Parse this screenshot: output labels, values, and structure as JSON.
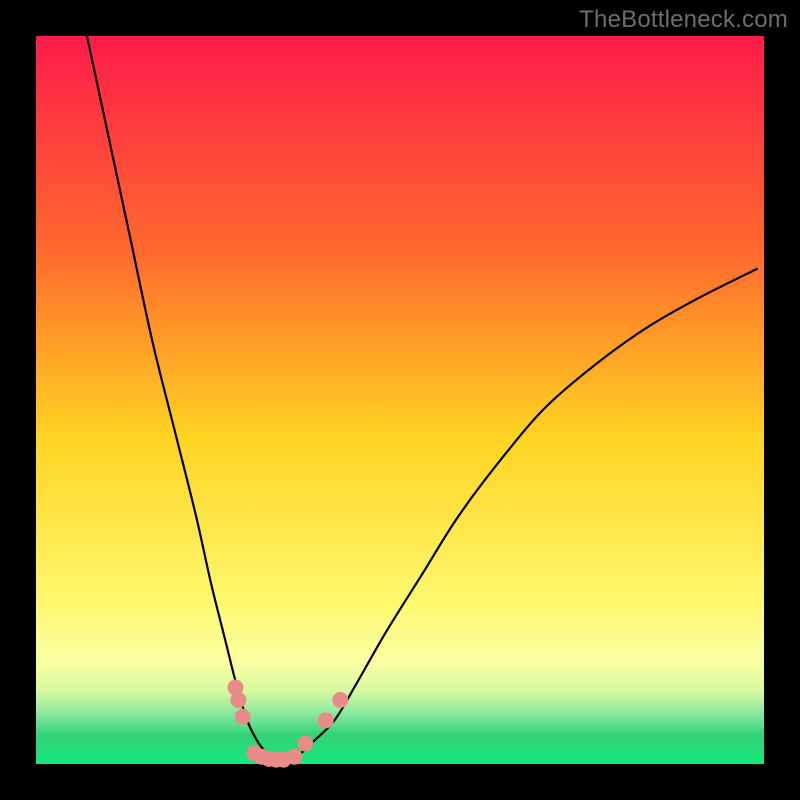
{
  "watermark": "TheBottleneck.com",
  "colors": {
    "border": "#000000",
    "grad_top": "#ff1b4b",
    "grad_mid1": "#ff6b2d",
    "grad_mid2": "#ffd321",
    "grad_mid3": "#fff870",
    "grad_low_yellow": "#fbffa3",
    "grad_band_green1": "#6be689",
    "grad_band_green2": "#35d27a",
    "grad_bottom": "#14e97a",
    "curve": "#000000",
    "dot_fill": "#e98b86",
    "dot_stroke": "#c05a55"
  },
  "chart_data": {
    "type": "line",
    "title": "",
    "xlabel": "",
    "ylabel": "",
    "xlim": [
      0,
      100
    ],
    "ylim": [
      0,
      100
    ],
    "series": [
      {
        "name": "bottleneck-curve",
        "x": [
          7,
          10,
          13,
          16,
          19,
          22,
          24,
          26,
          27.5,
          29,
          30.5,
          32,
          33,
          34,
          36,
          38,
          41,
          44,
          48,
          53,
          58,
          64,
          70,
          77,
          84,
          91,
          99
        ],
        "y": [
          100,
          86,
          72,
          58,
          46,
          34,
          25,
          17,
          11,
          6,
          3,
          1.2,
          0.6,
          0.6,
          1.2,
          3,
          6,
          11,
          18,
          26,
          34,
          42,
          49,
          55,
          60,
          64,
          68
        ]
      }
    ],
    "dots": [
      {
        "x": 27.4,
        "y": 10.5
      },
      {
        "x": 27.8,
        "y": 8.8
      },
      {
        "x": 28.4,
        "y": 6.5
      },
      {
        "x": 30.0,
        "y": 1.5
      },
      {
        "x": 31.0,
        "y": 1.0
      },
      {
        "x": 32.0,
        "y": 0.7
      },
      {
        "x": 33.0,
        "y": 0.6
      },
      {
        "x": 34.0,
        "y": 0.6
      },
      {
        "x": 35.5,
        "y": 1.0
      },
      {
        "x": 37.0,
        "y": 2.8
      },
      {
        "x": 39.8,
        "y": 6.0
      },
      {
        "x": 41.8,
        "y": 8.8
      }
    ]
  }
}
